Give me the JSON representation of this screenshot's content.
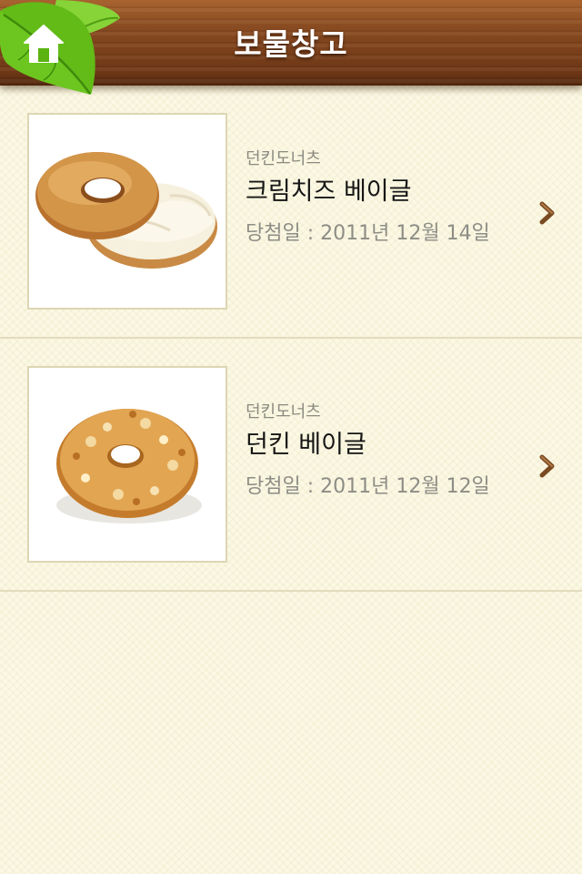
{
  "header": {
    "title": "보물창고",
    "home_icon": "home-icon"
  },
  "colors": {
    "background": "#fbf8e4",
    "header_wood": "#7a401b",
    "leaf_green": "#6bc61e",
    "chevron": "#7a4a22"
  },
  "items": [
    {
      "brand": "던킨도너츠",
      "name": "크림치즈 베이글",
      "date": "당첨일 : 2011년 12월 14일",
      "image": "cream-cheese-bagel-image",
      "chevron_icon": "chevron-right-icon"
    },
    {
      "brand": "던킨도너츠",
      "name": "던킨 베이글",
      "date": "당첨일 : 2011년 12월 12일",
      "image": "dunkin-bagel-image",
      "chevron_icon": "chevron-right-icon"
    }
  ]
}
